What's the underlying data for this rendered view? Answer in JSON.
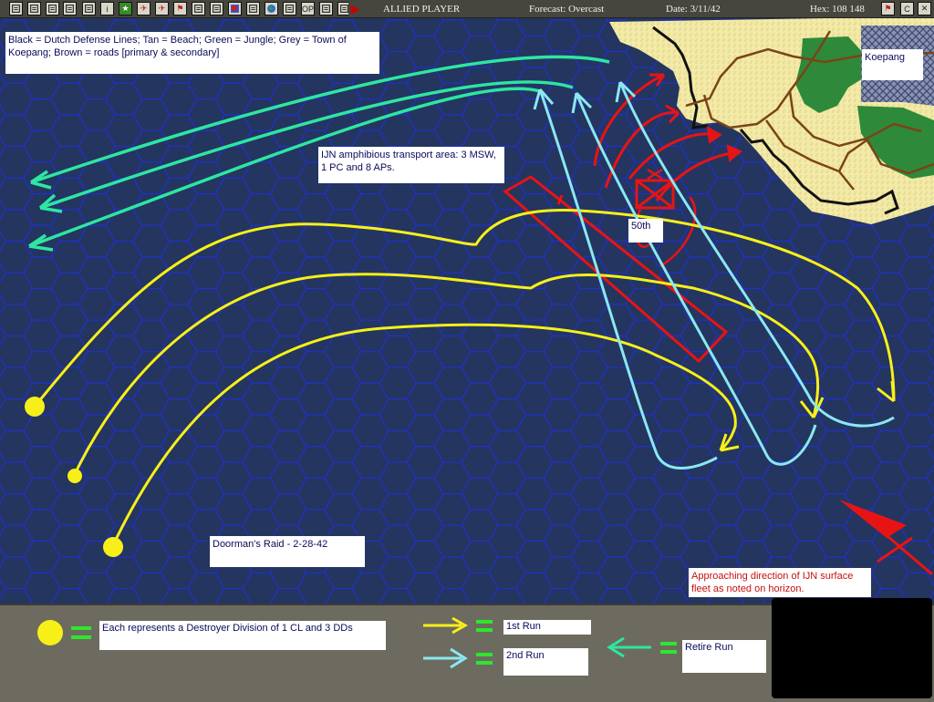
{
  "topbar": {
    "player": "ALLIED PLAYER",
    "forecast": "Forecast: Overcast",
    "date": "Date: 3/11/42",
    "hex": "Hex: 108 148",
    "buttons": [
      {
        "name": "window-icon",
        "glyph": ""
      },
      {
        "name": "document-icon",
        "glyph": ""
      },
      {
        "name": "report-icon",
        "glyph": ""
      },
      {
        "name": "copy-icon",
        "glyph": ""
      },
      {
        "name": "list-icon",
        "glyph": ""
      },
      {
        "name": "info-icon",
        "glyph": "i"
      },
      {
        "name": "star-icon",
        "glyph": "★"
      },
      {
        "name": "plane-icon",
        "glyph": "✈"
      },
      {
        "name": "plane-red-icon",
        "glyph": "✈"
      },
      {
        "name": "flag-icon",
        "glyph": "⚑"
      },
      {
        "name": "ground-unit-icon",
        "glyph": ""
      },
      {
        "name": "route-icon",
        "glyph": ""
      },
      {
        "name": "red-blue-icon",
        "glyph": ""
      },
      {
        "name": "base-icon",
        "glyph": ""
      },
      {
        "name": "globe-icon",
        "glyph": ""
      },
      {
        "name": "settings-icon",
        "glyph": ""
      },
      {
        "name": "op-icon",
        "glyph": "OP"
      },
      {
        "name": "filter-icon",
        "glyph": ""
      },
      {
        "name": "eye-icon",
        "glyph": ""
      },
      {
        "name": "end-turn-icon",
        "glyph": "▶"
      }
    ],
    "right_buttons": [
      {
        "name": "map-flag-icon",
        "glyph": "⚑"
      },
      {
        "name": "c-icon",
        "glyph": "C"
      },
      {
        "name": "close-icon",
        "glyph": "✕"
      }
    ]
  },
  "map": {
    "legend_note": "Black = Dutch Defense Lines; Tan = Beach; Green = Jungle; Grey = Town of Koepang; Brown = roads [primary & secondary]",
    "koepang": "Koepang",
    "transport_note": "IJN amphibious transport area: 3 MSW, 1 PC and 8 APs.",
    "unit_label": "50th",
    "raid_label": "Doorman's Raid - 2-28-42",
    "approach_note": "Approaching direction of IJN surface fleet as noted on horizon."
  },
  "legend": {
    "destroyer_division": "Each represents a Destroyer Division of 1 CL and 3 DDs",
    "first_run": "1st Run",
    "second_run": "2nd Run",
    "retire_run": "Retire Run"
  },
  "colors": {
    "sea": "#243560",
    "hex_grid": "#1d2fe0",
    "yellow": "#f7f018",
    "cyan": "#8ae8f2",
    "green": "#2ee6a0",
    "red": "#e81414",
    "beach": "#f2e8a0",
    "jungle": "#2e8a3a",
    "road": "#7a4418"
  }
}
